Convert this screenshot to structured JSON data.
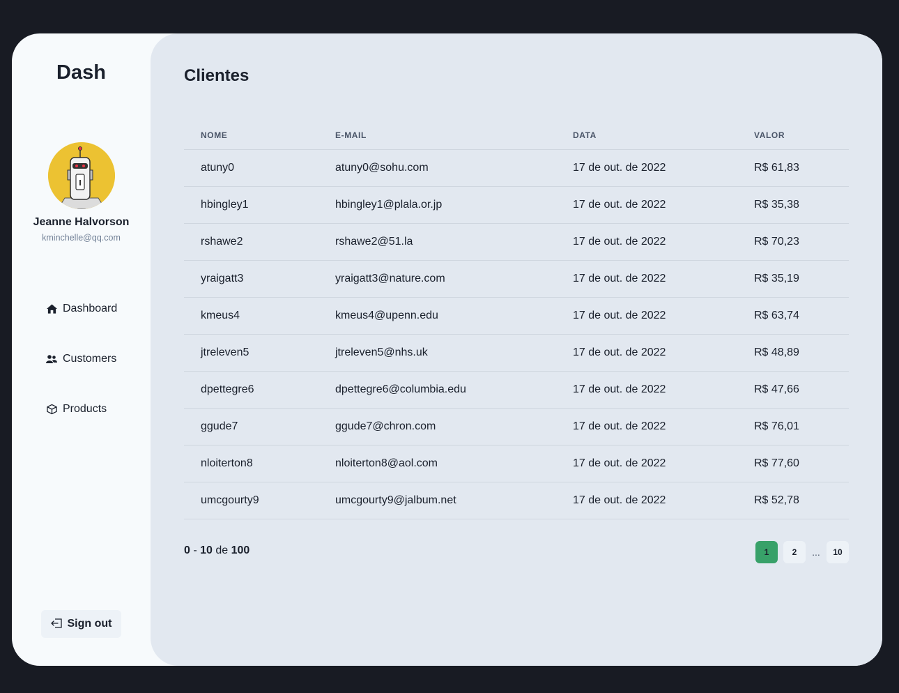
{
  "sidebar": {
    "logo": "Dash",
    "user": {
      "name": "Jeanne Halvorson",
      "email": "kminchelle@qq.com"
    },
    "nav": [
      {
        "label": "Dashboard",
        "icon": "home-icon"
      },
      {
        "label": "Customers",
        "icon": "users-icon"
      },
      {
        "label": "Products",
        "icon": "cube-icon"
      }
    ],
    "signout_label": "Sign out"
  },
  "main": {
    "title": "Clientes",
    "columns": [
      "NOME",
      "E-MAIL",
      "DATA",
      "VALOR"
    ],
    "rows": [
      {
        "nome": "atuny0",
        "email": "atuny0@sohu.com",
        "data": "17 de out. de 2022",
        "valor": "R$ 61,83"
      },
      {
        "nome": "hbingley1",
        "email": "hbingley1@plala.or.jp",
        "data": "17 de out. de 2022",
        "valor": "R$ 35,38"
      },
      {
        "nome": "rshawe2",
        "email": "rshawe2@51.la",
        "data": "17 de out. de 2022",
        "valor": "R$ 70,23"
      },
      {
        "nome": "yraigatt3",
        "email": "yraigatt3@nature.com",
        "data": "17 de out. de 2022",
        "valor": "R$ 35,19"
      },
      {
        "nome": "kmeus4",
        "email": "kmeus4@upenn.edu",
        "data": "17 de out. de 2022",
        "valor": "R$ 63,74"
      },
      {
        "nome": "jtreleven5",
        "email": "jtreleven5@nhs.uk",
        "data": "17 de out. de 2022",
        "valor": "R$ 48,89"
      },
      {
        "nome": "dpettegre6",
        "email": "dpettegre6@columbia.edu",
        "data": "17 de out. de 2022",
        "valor": "R$ 47,66"
      },
      {
        "nome": "ggude7",
        "email": "ggude7@chron.com",
        "data": "17 de out. de 2022",
        "valor": "R$ 76,01"
      },
      {
        "nome": "nloiterton8",
        "email": "nloiterton8@aol.com",
        "data": "17 de out. de 2022",
        "valor": "R$ 77,60"
      },
      {
        "nome": "umcgourty9",
        "email": "umcgourty9@jalbum.net",
        "data": "17 de out. de 2022",
        "valor": "R$ 52,78"
      }
    ],
    "summary": {
      "from": "0",
      "dash": " - ",
      "to": "10",
      "of_word": " de ",
      "total": "100"
    },
    "pagination": {
      "pages": [
        "1",
        "2",
        "10"
      ],
      "ellipsis": "...",
      "current": "1"
    }
  },
  "colors": {
    "background": "#181b23",
    "sidebar": "#f7fafc",
    "main": "#e2e8f0",
    "accent": "#38a169",
    "avatar_bg": "#ecc232"
  }
}
